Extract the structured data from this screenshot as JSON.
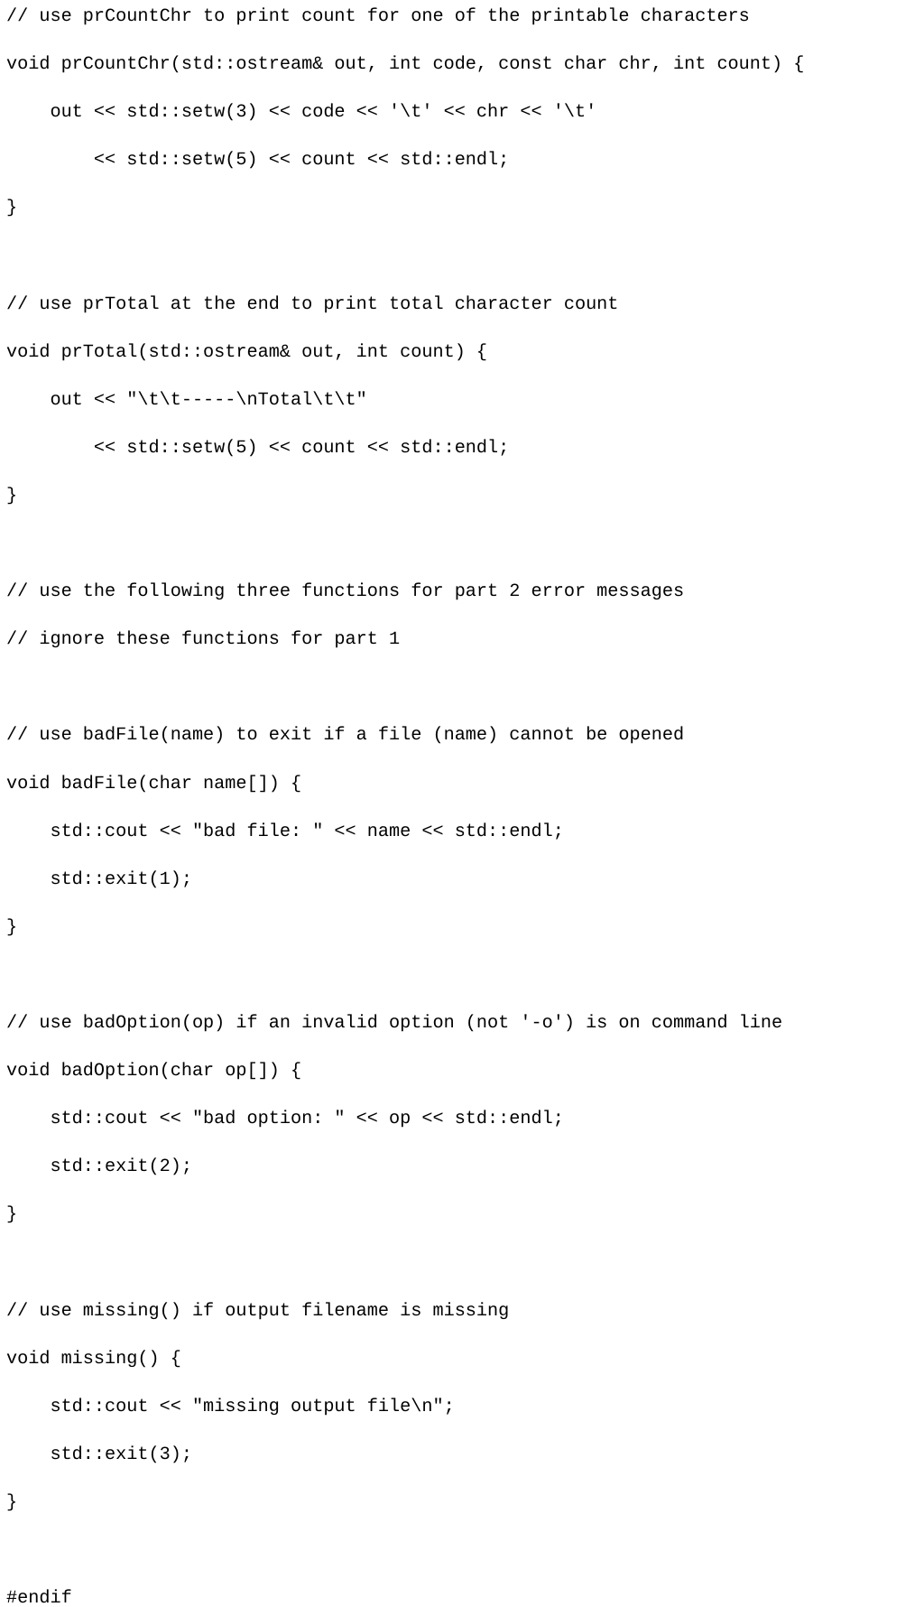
{
  "document": {
    "kind": "source-code-listing",
    "language": "C++",
    "background_color": "#ffffff",
    "text_color": "#000000"
  },
  "code": {
    "lines": [
      "// use prCountChr to print count for one of the printable characters",
      "void prCountChr(std::ostream& out, int code, const char chr, int count) {",
      "    out << std::setw(3) << code << '\\t' << chr << '\\t'",
      "        << std::setw(5) << count << std::endl;",
      "}",
      "",
      "// use prTotal at the end to print total character count",
      "void prTotal(std::ostream& out, int count) {",
      "    out << \"\\t\\t-----\\nTotal\\t\\t\"",
      "        << std::setw(5) << count << std::endl;",
      "}",
      "",
      "// use the following three functions for part 2 error messages",
      "// ignore these functions for part 1",
      "",
      "// use badFile(name) to exit if a file (name) cannot be opened",
      "void badFile(char name[]) {",
      "    std::cout << \"bad file: \" << name << std::endl;",
      "    std::exit(1);",
      "}",
      "",
      "// use badOption(op) if an invalid option (not '-o') is on command line",
      "void badOption(char op[]) {",
      "    std::cout << \"bad option: \" << op << std::endl;",
      "    std::exit(2);",
      "}",
      "",
      "// use missing() if output filename is missing",
      "void missing() {",
      "    std::cout << \"missing output file\\n\";",
      "    std::exit(3);",
      "}",
      "",
      "#endif"
    ]
  }
}
